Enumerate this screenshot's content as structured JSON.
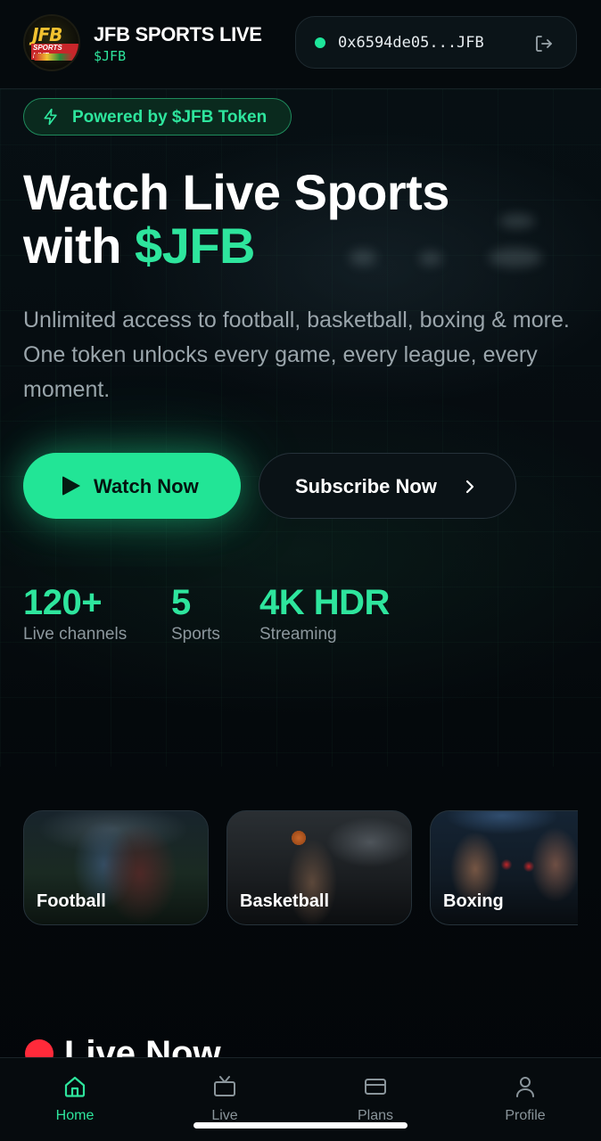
{
  "header": {
    "brand_name": "JFB SPORTS LIVE",
    "brand_ticker": "$JFB",
    "logo_text_top": "JFB",
    "logo_text_bottom": "SPORTS LIVE",
    "wallet_address": "0x6594de05...JFB",
    "wallet_status_color": "#1ee59a"
  },
  "hero": {
    "badge": "Powered by $JFB Token",
    "title_line1": "Watch Live Sports",
    "title_line2_prefix": "with ",
    "title_line2_accent": "$JFB",
    "subtitle": "Unlimited access to football, basketball, boxing & more. One token unlocks every game, every league, every moment.",
    "primary_button": "Watch Now",
    "secondary_button": "Subscribe Now"
  },
  "stats": [
    {
      "value": "120+",
      "label": "Live channels"
    },
    {
      "value": "5",
      "label": "Sports"
    },
    {
      "value": "4K HDR",
      "label": "Streaming"
    }
  ],
  "sports": [
    {
      "label": "Football"
    },
    {
      "label": "Basketball"
    },
    {
      "label": "Boxing"
    }
  ],
  "live_section": {
    "title": "Live Now"
  },
  "tabbar": {
    "items": [
      {
        "label": "Home",
        "icon": "home-icon",
        "active": true
      },
      {
        "label": "Live",
        "icon": "tv-icon",
        "active": false
      },
      {
        "label": "Plans",
        "icon": "card-icon",
        "active": false
      },
      {
        "label": "Profile",
        "icon": "user-icon",
        "active": false
      }
    ]
  },
  "colors": {
    "accent": "#2ee59d",
    "background": "#04080b",
    "live_red": "#ff2a3a"
  }
}
